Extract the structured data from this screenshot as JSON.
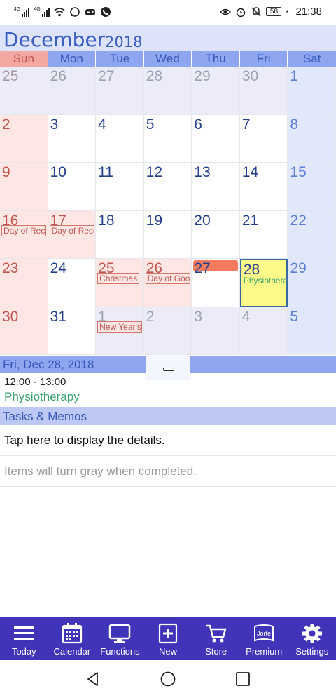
{
  "status_bar": {
    "time": "21:38",
    "battery": "58",
    "net_tags": [
      "4G",
      "4G"
    ],
    "icons": [
      "signal-icon",
      "signal-icon",
      "wifi-icon",
      "whatsapp-icon",
      "gamepad-icon",
      "phone-icon",
      "eye-icon",
      "alarm-icon",
      "mute-icon",
      "battery-icon",
      "charging-icon"
    ]
  },
  "header": {
    "month": "December",
    "year": "2018"
  },
  "weekdays": [
    "Sun",
    "Mon",
    "Tue",
    "Wed",
    "Thu",
    "Fri",
    "Sat"
  ],
  "weeks": [
    [
      {
        "day": "25",
        "kind": "other-sun"
      },
      {
        "day": "26",
        "kind": "other"
      },
      {
        "day": "27",
        "kind": "other"
      },
      {
        "day": "28",
        "kind": "other"
      },
      {
        "day": "29",
        "kind": "other"
      },
      {
        "day": "30",
        "kind": "other"
      },
      {
        "day": "1",
        "kind": "sat"
      }
    ],
    [
      {
        "day": "2",
        "kind": "sun"
      },
      {
        "day": "3",
        "kind": "weekday"
      },
      {
        "day": "4",
        "kind": "weekday"
      },
      {
        "day": "5",
        "kind": "weekday"
      },
      {
        "day": "6",
        "kind": "weekday"
      },
      {
        "day": "7",
        "kind": "weekday"
      },
      {
        "day": "8",
        "kind": "sat"
      }
    ],
    [
      {
        "day": "9",
        "kind": "sun"
      },
      {
        "day": "10",
        "kind": "weekday"
      },
      {
        "day": "11",
        "kind": "weekday"
      },
      {
        "day": "12",
        "kind": "weekday"
      },
      {
        "day": "13",
        "kind": "weekday"
      },
      {
        "day": "14",
        "kind": "weekday"
      },
      {
        "day": "15",
        "kind": "sat"
      }
    ],
    [
      {
        "day": "16",
        "kind": "sun",
        "tag": "Day of Reconciliation"
      },
      {
        "day": "17",
        "kind": "holiday",
        "tag": "Day of Reconciliation"
      },
      {
        "day": "18",
        "kind": "weekday"
      },
      {
        "day": "19",
        "kind": "weekday"
      },
      {
        "day": "20",
        "kind": "weekday"
      },
      {
        "day": "21",
        "kind": "weekday"
      },
      {
        "day": "22",
        "kind": "sat"
      }
    ],
    [
      {
        "day": "23",
        "kind": "sun"
      },
      {
        "day": "24",
        "kind": "weekday"
      },
      {
        "day": "25",
        "kind": "holiday",
        "tag": "Christmas"
      },
      {
        "day": "26",
        "kind": "holiday",
        "tag": "Day of Goodwill"
      },
      {
        "day": "27",
        "kind": "today"
      },
      {
        "day": "28",
        "kind": "selected",
        "event": "Physiotherapy"
      },
      {
        "day": "29",
        "kind": "sat"
      }
    ],
    [
      {
        "day": "30",
        "kind": "sun"
      },
      {
        "day": "31",
        "kind": "weekday"
      },
      {
        "day": "1",
        "kind": "other",
        "tag": "New Year's Day"
      },
      {
        "day": "2",
        "kind": "other"
      },
      {
        "day": "3",
        "kind": "other"
      },
      {
        "day": "4",
        "kind": "other"
      },
      {
        "day": "5",
        "kind": "other-sat"
      }
    ]
  ],
  "selected_date": "Fri, Dec 28, 2018",
  "event": {
    "time": "12:00 - 13:00",
    "title": "Physiotherapy"
  },
  "tasks": {
    "header": "Tasks & Memos",
    "rows": [
      "Tap here to display the details.",
      "Items will turn gray when completed."
    ]
  },
  "nav": [
    {
      "label": "Today",
      "icon": "menu-icon"
    },
    {
      "label": "Calendar",
      "icon": "calendar-icon"
    },
    {
      "label": "Functions",
      "icon": "monitor-icon"
    },
    {
      "label": "New",
      "icon": "plus-icon"
    },
    {
      "label": "Store",
      "icon": "cart-icon"
    },
    {
      "label": "Premium",
      "icon": "jorte-book-icon"
    },
    {
      "label": "Settings",
      "icon": "gear-icon"
    }
  ],
  "premium_icon_text": "Jorte",
  "colors": {
    "accent": "#3657b8",
    "nav_bg": "#4034b8",
    "holiday": "#c0564e",
    "event": "#3aa36f",
    "selected_cell": "#fdfa8a",
    "today_bar": "#f27a5e"
  }
}
